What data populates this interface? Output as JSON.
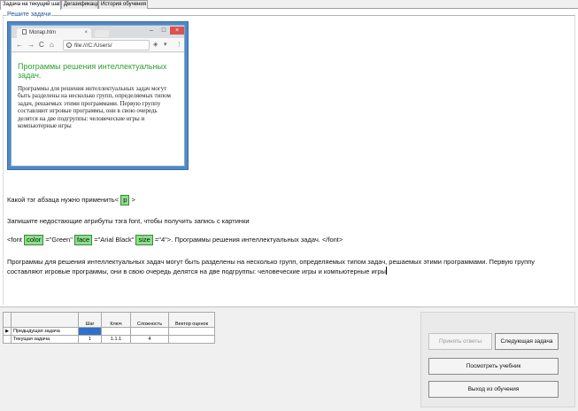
{
  "tabs": [
    {
      "label": "Задача на текущий шаг"
    },
    {
      "label": "Дегазификация"
    },
    {
      "label": "История обучения"
    }
  ],
  "group_caption": "Решите задачи",
  "browser": {
    "tab_title": "Мопар.htm",
    "close_glyph": "×",
    "url": "file:///C:/Users/",
    "win_min": "–",
    "win_max": "□",
    "win_close": "×",
    "heading": "Программы решения интеллектуальных задач.",
    "paragraph": "Программы для решения интеллектуальных задач могут быть разделены на несколько групп, определяемых типом задач, решаемых этими программами. Первую группу составляют игровые программы, они в свою очередь делятся на две подгруппы: человеческие игры и компьютерные игры"
  },
  "question1": {
    "text": "Какой тэг абзаца нужно применить<",
    "answer": "p",
    "suffix": ">"
  },
  "question2": {
    "text": "Запишите недостающие атрибуты тэга font, чтобы получить запись с картинки"
  },
  "question3": {
    "prefix": "<font ",
    "a1": "color",
    "t1": " =\"Green\" ",
    "a2": "face",
    "t2": " =\"Arial Black\" ",
    "a3": "size",
    "t3": " =\"4\">. Программы решения интеллектуальных задач.  </font>"
  },
  "paragraph_text": "Программы для решения интеллектуальных задач могут быть разделены на несколько групп, определяемых типом задач, решаемых этими программами. Первую группу составляют игровые программы, они в свою очередь делятся на две подгруппы: человеческие игры и компьютерные игры",
  "grid": {
    "columns": [
      "Шаг",
      "Ключ",
      "Сложность",
      "Вектор оценок"
    ],
    "rows": [
      {
        "marker": "▶",
        "label": "Предыдущая задача",
        "step": "",
        "key": "",
        "difficulty": "",
        "vector": ""
      },
      {
        "marker": "",
        "label": "Текущая задача",
        "step": "1",
        "key": "1.1.1",
        "difficulty": "4",
        "vector": ""
      }
    ]
  },
  "buttons": {
    "check": "Принять ответы",
    "next": "Следующая задача",
    "stats": "Посмотреть учебник",
    "exit": "Выход из обучения"
  }
}
